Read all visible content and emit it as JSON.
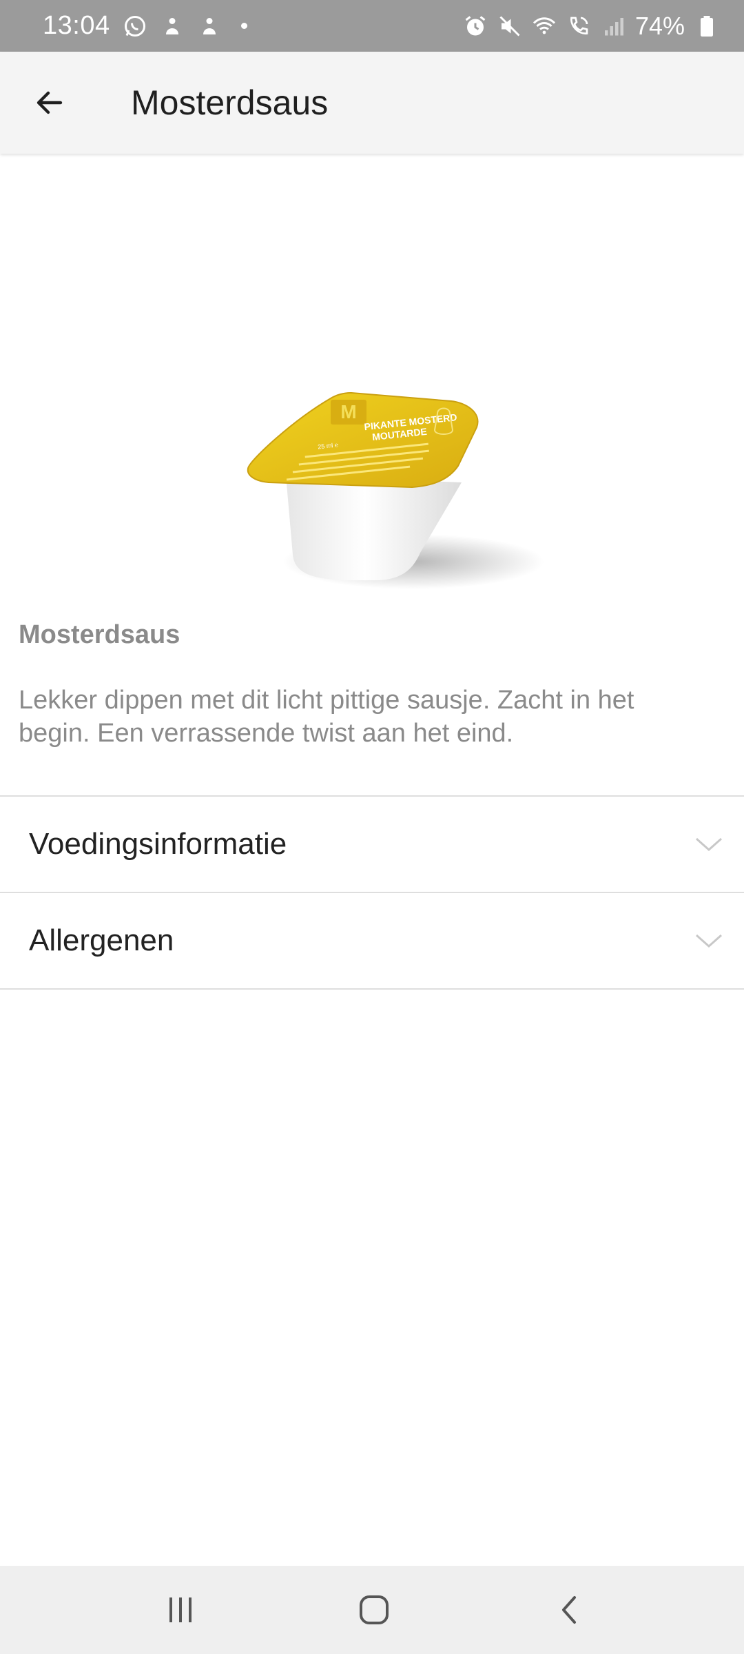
{
  "status_bar": {
    "time": "13:04",
    "battery_percent": "74%",
    "left_icons": [
      "whatsapp-icon",
      "notification-icon",
      "notification-icon",
      "more-dot-icon"
    ],
    "right_icons": [
      "alarm-icon",
      "mute-icon",
      "wifi-icon",
      "wifi-call-icon",
      "signal-icon",
      "battery-icon"
    ]
  },
  "app_bar": {
    "title": "Mosterdsaus",
    "back_icon": "arrow-left-icon"
  },
  "product": {
    "name": "Mosterdsaus",
    "description": "Lekker dippen met dit licht pittige sausje. Zacht in het begin. Een verrassende twist aan het eind.",
    "image": "sauce-cup-image",
    "image_label_line1": "PIKANTE MOSTERD",
    "image_label_line2": "MOUTARDE",
    "image_volume": "25 ml ℮"
  },
  "sections": [
    {
      "label": "Voedingsinformatie",
      "icon": "chevron-down-icon"
    },
    {
      "label": "Allergenen",
      "icon": "chevron-down-icon"
    }
  ],
  "colors": {
    "status_bar": "#9b9b9b",
    "app_bar": "#f4f4f4",
    "lid_yellow": "#e5c11a",
    "secondary_text": "#8a8a8a",
    "divider": "#dedede"
  },
  "nav_bar": {
    "buttons": [
      "recent-apps-icon",
      "home-icon",
      "back-icon"
    ]
  }
}
